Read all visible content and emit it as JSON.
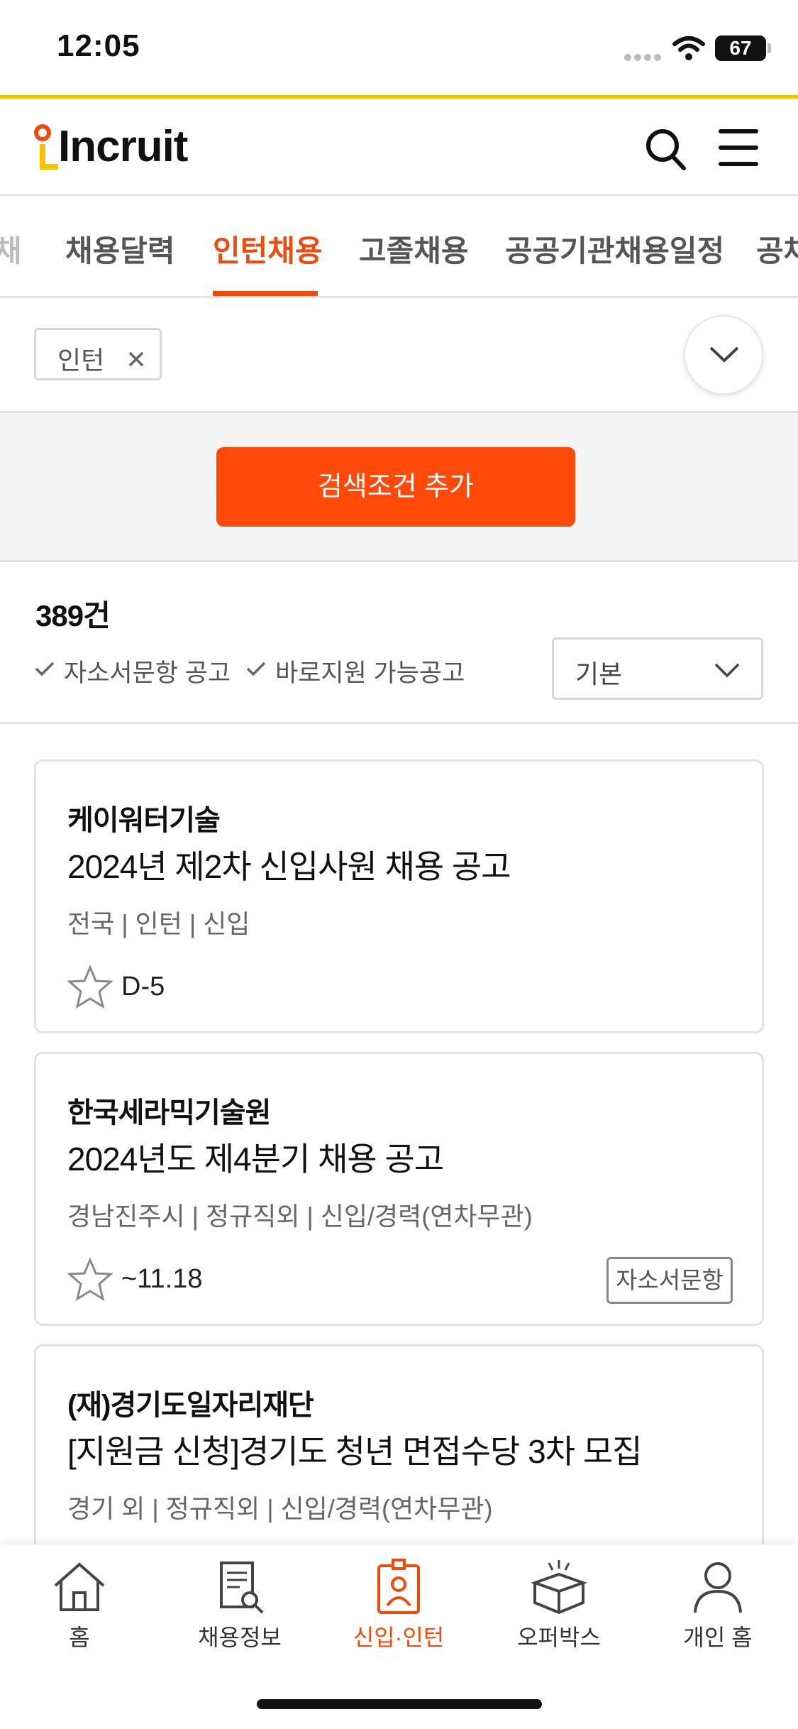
{
  "status_bar": {
    "time": "12:05",
    "battery": "67"
  },
  "header": {
    "logo_text": "Incruit"
  },
  "tabs": [
    {
      "label": "채용달력"
    },
    {
      "label": "인턴채용"
    },
    {
      "label": "고졸채용"
    },
    {
      "label": "공공기관채용일정"
    },
    {
      "label": "공채"
    }
  ],
  "filter": {
    "chip_label": "인턴"
  },
  "search": {
    "add_condition_label": "검색조건 추가"
  },
  "results": {
    "count": "389건",
    "option_1": "자소서문항 공고",
    "option_2": "바로지원 가능공고",
    "sort_label": "기본"
  },
  "jobs": [
    {
      "company": "케이워터기술",
      "title": "2024년 제2차 신입사원 채용 공고",
      "meta": "전국 | 인턴 | 신입",
      "deadline": "D-5",
      "badge": ""
    },
    {
      "company": "한국세라믹기술원",
      "title": "2024년도 제4분기 채용 공고",
      "meta": "경남진주시 | 정규직외 | 신입/경력(연차무관)",
      "deadline": "~11.18",
      "badge": "자소서문항"
    },
    {
      "company": "(재)경기도일자리재단",
      "title": "[지원금 신청]경기도 청년 면접수당 3차 모집",
      "meta": "경기 외 | 정규직외 | 신입/경력(연차무관)",
      "deadline": "",
      "badge": ""
    }
  ],
  "bottom_nav": [
    {
      "label": "홈",
      "icon": "home-icon"
    },
    {
      "label": "채용정보",
      "icon": "document-search-icon"
    },
    {
      "label": "신입·인턴",
      "icon": "id-badge-icon"
    },
    {
      "label": "오퍼박스",
      "icon": "offer-box-icon"
    },
    {
      "label": "개인 홈",
      "icon": "person-icon"
    }
  ],
  "colors": {
    "accent": "#f04a0c",
    "button": "#ff4a0a",
    "header_line": "#f5c300"
  }
}
